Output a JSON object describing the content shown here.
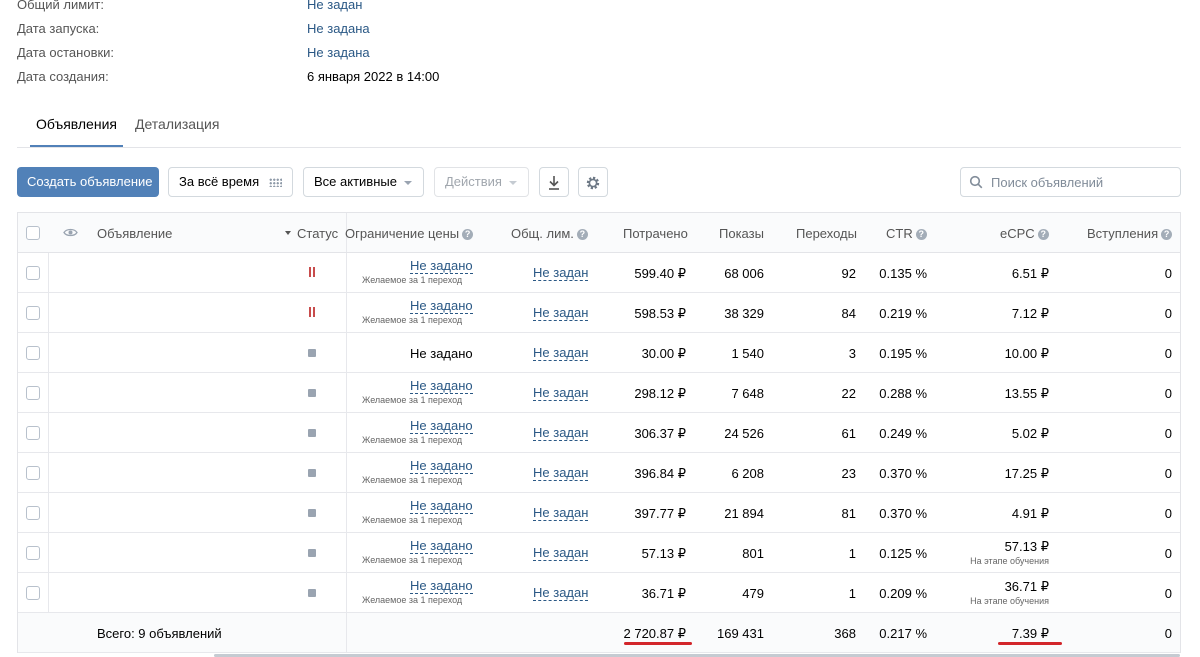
{
  "info": {
    "rows": [
      {
        "label": "Общий лимит:",
        "value": "Не задан"
      },
      {
        "label": "Дата запуска:",
        "value": "Не задана"
      },
      {
        "label": "Дата остановки:",
        "value": "Не задана"
      },
      {
        "label": "Дата создания:",
        "value": "6 января 2022 в 14:00"
      }
    ]
  },
  "tabs": [
    {
      "label": "Объявления",
      "active": true
    },
    {
      "label": "Детализация",
      "active": false
    }
  ],
  "toolbar": {
    "create_label": "Создать объявление",
    "period_label": "За всё время",
    "filter_label": "Все активные",
    "actions_label": "Действия",
    "search_placeholder": "Поиск объявлений"
  },
  "table": {
    "headers": {
      "ad": "Объявление",
      "status": "Статус",
      "price_limit": "Ограничение цены",
      "total_limit": "Общ. лим.",
      "spent": "Потрачено",
      "impressions": "Показы",
      "clicks": "Переходы",
      "ctr": "CTR",
      "ecpc": "eCPC",
      "joins": "Вступления"
    },
    "price_limit_sub": "Желаемое за 1 переход",
    "ecpc_sub": "На этапе обучения",
    "rows": [
      {
        "status": "paused",
        "price_limit": "Не задано",
        "sub": true,
        "total_limit": "Не задан",
        "spent": "599.40 ₽",
        "impressions": "68 006",
        "clicks": "92",
        "ctr": "0.135 %",
        "ecpc": "6.51 ₽",
        "ecpc_learning": false,
        "joins": "0"
      },
      {
        "status": "paused",
        "price_limit": "Не задано",
        "sub": true,
        "total_limit": "Не задан",
        "spent": "598.53 ₽",
        "impressions": "38 329",
        "clicks": "84",
        "ctr": "0.219 %",
        "ecpc": "7.12 ₽",
        "ecpc_learning": false,
        "joins": "0"
      },
      {
        "status": "stopped",
        "price_limit": "Не задано",
        "sub": false,
        "total_limit": "Не задан",
        "spent": "30.00 ₽",
        "impressions": "1 540",
        "clicks": "3",
        "ctr": "0.195 %",
        "ecpc": "10.00 ₽",
        "ecpc_learning": false,
        "joins": "0"
      },
      {
        "status": "stopped",
        "price_limit": "Не задано",
        "sub": true,
        "total_limit": "Не задан",
        "spent": "298.12 ₽",
        "impressions": "7 648",
        "clicks": "22",
        "ctr": "0.288 %",
        "ecpc": "13.55 ₽",
        "ecpc_learning": false,
        "joins": "0"
      },
      {
        "status": "stopped",
        "price_limit": "Не задано",
        "sub": true,
        "total_limit": "Не задан",
        "spent": "306.37 ₽",
        "impressions": "24 526",
        "clicks": "61",
        "ctr": "0.249 %",
        "ecpc": "5.02 ₽",
        "ecpc_learning": false,
        "joins": "0"
      },
      {
        "status": "stopped",
        "price_limit": "Не задано",
        "sub": true,
        "total_limit": "Не задан",
        "spent": "396.84 ₽",
        "impressions": "6 208",
        "clicks": "23",
        "ctr": "0.370 %",
        "ecpc": "17.25 ₽",
        "ecpc_learning": false,
        "joins": "0"
      },
      {
        "status": "stopped",
        "price_limit": "Не задано",
        "sub": true,
        "total_limit": "Не задан",
        "spent": "397.77 ₽",
        "impressions": "21 894",
        "clicks": "81",
        "ctr": "0.370 %",
        "ecpc": "4.91 ₽",
        "ecpc_learning": false,
        "joins": "0"
      },
      {
        "status": "stopped",
        "price_limit": "Не задано",
        "sub": true,
        "total_limit": "Не задан",
        "spent": "57.13 ₽",
        "impressions": "801",
        "clicks": "1",
        "ctr": "0.125 %",
        "ecpc": "57.13 ₽",
        "ecpc_learning": true,
        "joins": "0"
      },
      {
        "status": "stopped",
        "price_limit": "Не задано",
        "sub": true,
        "total_limit": "Не задан",
        "spent": "36.71 ₽",
        "impressions": "479",
        "clicks": "1",
        "ctr": "0.209 %",
        "ecpc": "36.71 ₽",
        "ecpc_learning": true,
        "joins": "0"
      }
    ],
    "total": {
      "label": "Всего: 9 объявлений",
      "spent": "2 720.87 ₽",
      "impressions": "169 431",
      "clicks": "368",
      "ctr": "0.217 %",
      "ecpc": "7.39 ₽",
      "joins": "0"
    }
  },
  "colors": {
    "accent": "#5181b8",
    "link": "#2a5885",
    "highlight_underline": "#d2252a",
    "pause_status": "#c84c4c"
  }
}
